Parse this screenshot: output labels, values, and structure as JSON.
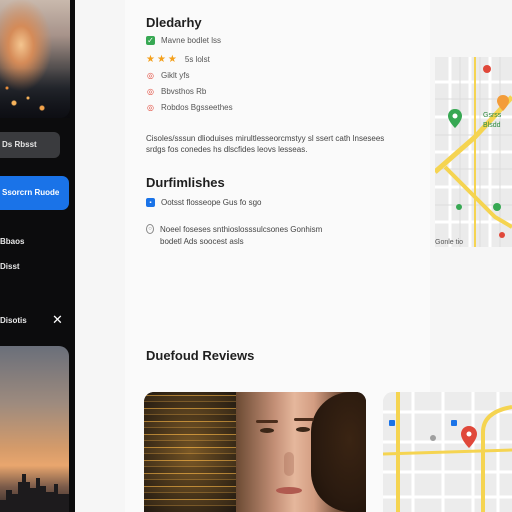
{
  "sidebar": {
    "muted_button": "Ds Rbsst",
    "primary_button": "Ssorcrn Ruode",
    "links": [
      "Bbaos",
      "Disst"
    ],
    "panel_label": "Disotis",
    "close_glyph": "✕"
  },
  "details": {
    "title": "Dledarhy",
    "rows": [
      {
        "icon": "square-check-icon",
        "text": "Mavne bodlet lss"
      },
      {
        "icon": "star-icon",
        "text": "5s lolst"
      },
      {
        "icon": "location-pin-icon",
        "text": "Giklt yfs"
      },
      {
        "icon": "location-pin-icon",
        "text": "Bbvsthos Rb"
      },
      {
        "icon": "location-pin-icon",
        "text": "Robdos Bgsseethes"
      }
    ],
    "paragraph": "Cisoles/sssun dlioduises mirultlesseorcmstyy sl ssert cath lnsesees srdgs fos conedes hs dlscfides leovs lesseas."
  },
  "features": {
    "title": "Durfimlishes",
    "items": [
      {
        "icon": "blue-badge-icon",
        "text": "Ootsst flosseope Gus fo sgo"
      },
      {
        "icon": "outline-circle-icon",
        "text": "Noeel foseses snthioslosssulcsones Gonhism bodetl Ads soocest asls"
      }
    ]
  },
  "map_top_caption": "Gonle tio",
  "map_top_labels": [
    "Gsrss",
    "Blsdd"
  ],
  "reviews": {
    "title": "Duefoud Reviews"
  },
  "colors": {
    "accent": "#1a73e8",
    "sidebar_bg": "#0c0c0d",
    "star": "#f4a01c",
    "map_road": "#f5d451",
    "map_pin_red": "#e0483a",
    "map_pin_green": "#37a853"
  }
}
